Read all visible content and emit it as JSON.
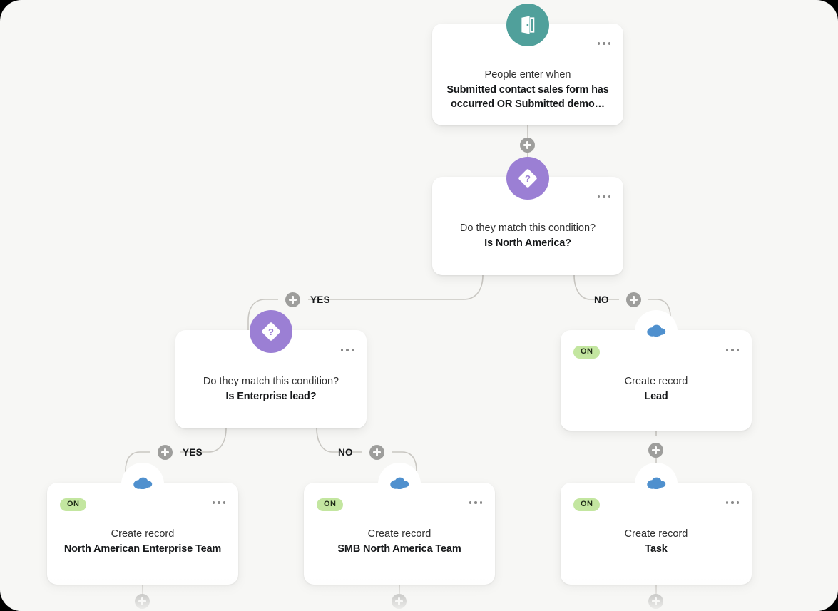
{
  "canvas": {
    "background": "#f7f7f5",
    "wire_color": "#c9c7c2"
  },
  "nodes": [
    {
      "id": "trigger",
      "icon": "door-open-icon",
      "icon_style": "teal",
      "icon_color": "#50a09b",
      "sub_label": "People enter when",
      "main_label": "Submitted contact sales form has occurred OR Submitted demo…",
      "menu": "more-options",
      "status": null
    },
    {
      "id": "condition-na",
      "icon": "condition-diamond-icon",
      "icon_style": "purple",
      "icon_color": "#9b7fd4",
      "sub_label": "Do they match this condition?",
      "main_label": "Is North America?",
      "menu": "more-options",
      "status": null
    },
    {
      "id": "condition-enterprise",
      "icon": "condition-diamond-icon",
      "icon_style": "purple",
      "icon_color": "#9b7fd4",
      "sub_label": "Do they match this condition?",
      "main_label": "Is Enterprise lead?",
      "menu": "more-options",
      "status": null
    },
    {
      "id": "action-lead",
      "icon": "salesforce-cloud-icon",
      "icon_style": "white",
      "icon_color": "#4f90ce",
      "sub_label": "Create record",
      "main_label": "Lead",
      "menu": "more-options",
      "status": "ON"
    },
    {
      "id": "action-na-enterprise-team",
      "icon": "salesforce-cloud-icon",
      "icon_style": "white",
      "icon_color": "#4f90ce",
      "sub_label": "Create record",
      "main_label": "North American Enterprise Team",
      "menu": "more-options",
      "status": "ON"
    },
    {
      "id": "action-smb-na-team",
      "icon": "salesforce-cloud-icon",
      "icon_style": "white",
      "icon_color": "#4f90ce",
      "sub_label": "Create record",
      "main_label": "SMB North America Team",
      "menu": "more-options",
      "status": "ON"
    },
    {
      "id": "action-task",
      "icon": "salesforce-cloud-icon",
      "icon_style": "white",
      "icon_color": "#4f90ce",
      "sub_label": "Create record",
      "main_label": "Task",
      "menu": "more-options",
      "status": "ON"
    }
  ],
  "branches": [
    {
      "id": "na-yes",
      "label": "YES"
    },
    {
      "id": "na-no",
      "label": "NO"
    },
    {
      "id": "enterprise-yes",
      "label": "YES"
    },
    {
      "id": "enterprise-no",
      "label": "NO"
    }
  ],
  "add_buttons": [
    {
      "id": "add-after-trigger"
    },
    {
      "id": "add-na-yes"
    },
    {
      "id": "add-na-no"
    },
    {
      "id": "add-enterprise-yes"
    },
    {
      "id": "add-enterprise-no"
    },
    {
      "id": "add-after-lead"
    },
    {
      "id": "add-after-na-enterprise-team"
    },
    {
      "id": "add-after-smb-na-team"
    },
    {
      "id": "add-after-task"
    }
  ],
  "status_badge": {
    "on_label": "ON",
    "background": "#c3e6a0",
    "text_color": "#1f2b18"
  }
}
